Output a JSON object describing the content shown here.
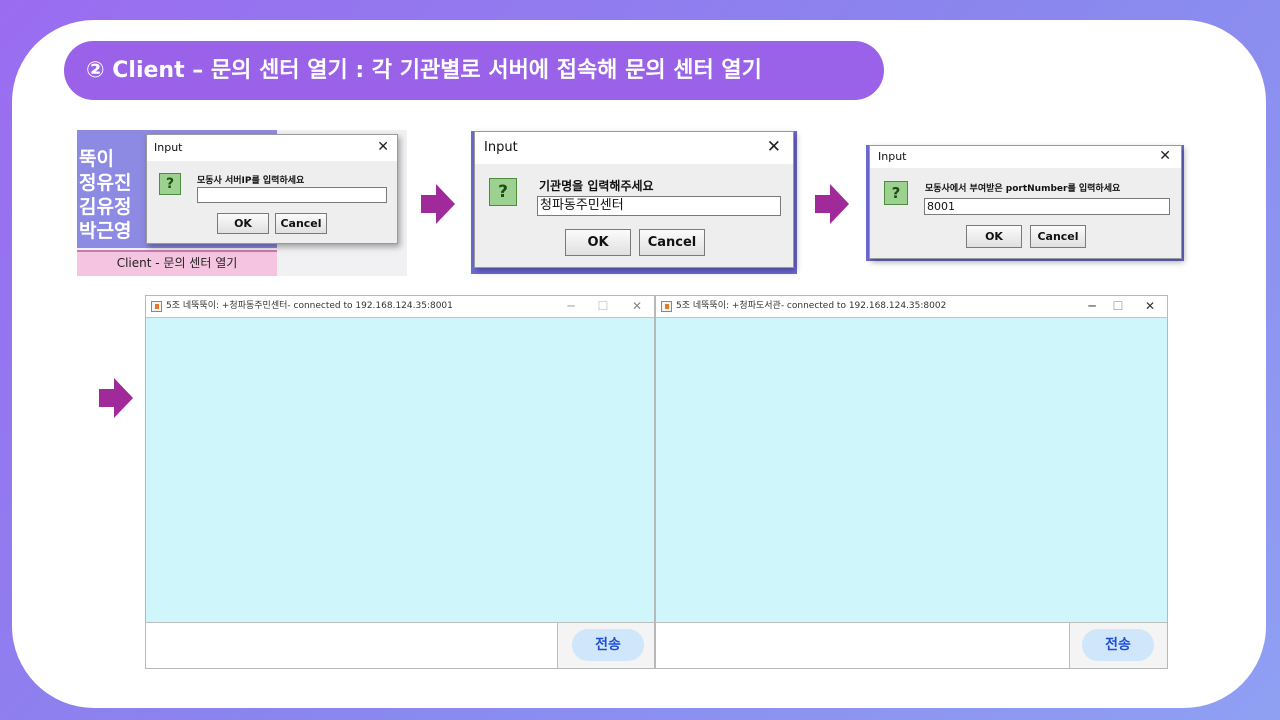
{
  "banner": {
    "title": "② Client – 문의 센터 열기 : 각 기관별로 서버에 접속해 문의 센터 열기"
  },
  "colors": {
    "accent": "#9a62e8",
    "arrow": "#a02a9a",
    "chat_bg": "#cef6fb",
    "send_button": "#cfe6fb"
  },
  "slide_names": [
    "뚝이",
    "정유진",
    "김유정",
    "박근영"
  ],
  "slide_button_label": "Client - 문의 센터 열기",
  "dialog1": {
    "title": "Input",
    "icon": "?",
    "close": "✕",
    "message": "모동사 서버IP를 입력하세요",
    "value": "",
    "ok": "OK",
    "cancel": "Cancel"
  },
  "dialog2": {
    "title": "Input",
    "icon": "?",
    "close": "✕",
    "message": "기관명을 입력해주세요",
    "value": "청파동주민센터",
    "ok": "OK",
    "cancel": "Cancel"
  },
  "dialog3": {
    "title": "Input",
    "icon": "?",
    "close": "✕",
    "message": "모동사에서 부여받은 portNumber를 입력하세요",
    "value": "8001",
    "ok": "OK",
    "cancel": "Cancel"
  },
  "window1": {
    "title": "5조 네뚝뚝이: +청파동주민센터- connected to 192.168.124.35:8001",
    "minimize": "─",
    "maximize": "☐",
    "close": "✕",
    "send": "전송"
  },
  "window2": {
    "title": "5조 네뚝뚝이: +청파도서관- connected to 192.168.124.35:8002",
    "minimize": "─",
    "maximize": "☐",
    "close": "✕",
    "send": "전송"
  },
  "icons": [
    "arrow-right-icon",
    "question-icon",
    "java-app-icon",
    "close-icon",
    "minimize-icon",
    "maximize-icon"
  ]
}
